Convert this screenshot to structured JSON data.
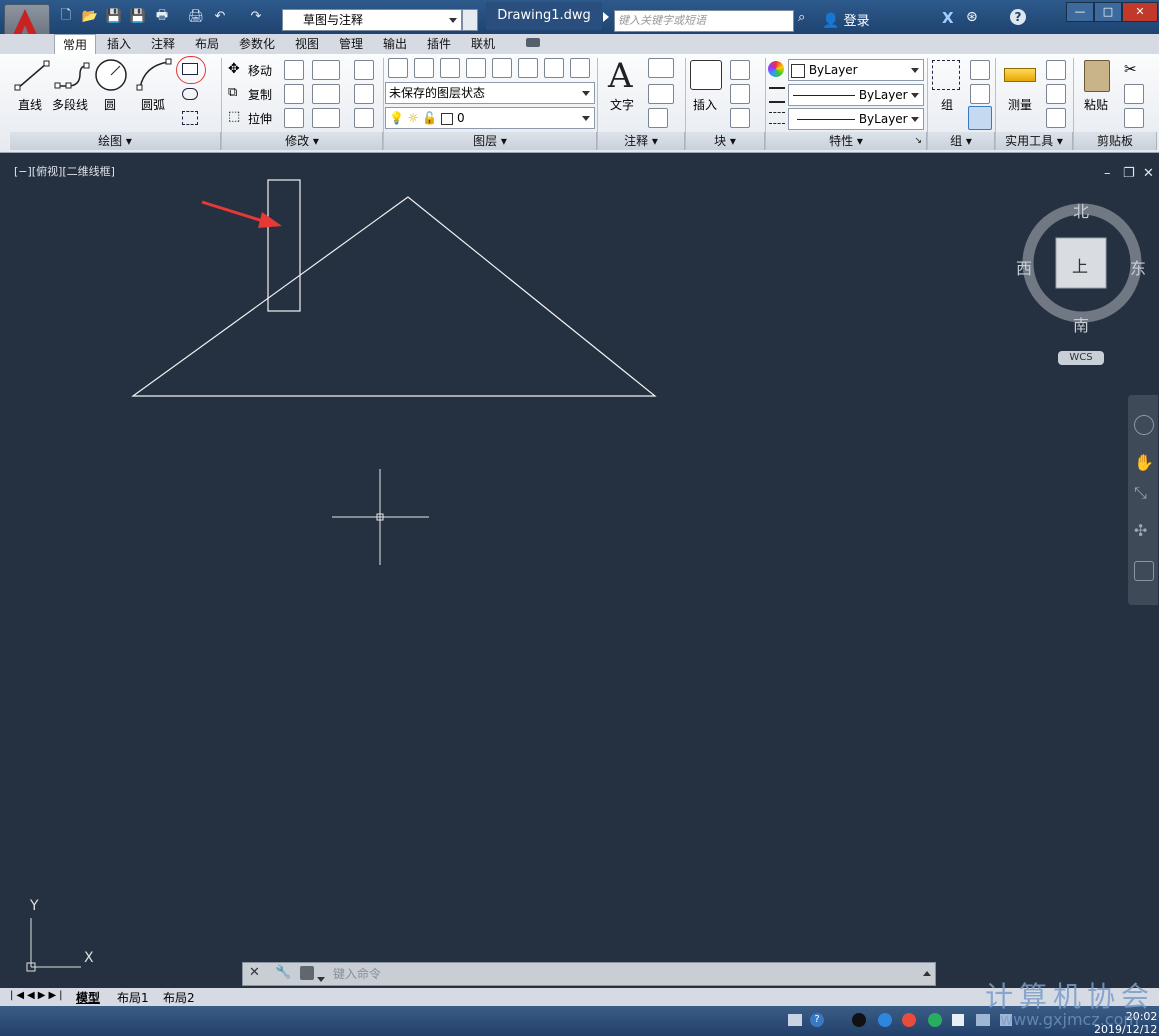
{
  "title_bar": {
    "workspace": "草图与注释",
    "document_title": "Drawing1.dwg",
    "search_placeholder": "键入关键字或短语",
    "login": "登录"
  },
  "ribbon_tabs": [
    "常用",
    "插入",
    "注释",
    "布局",
    "参数化",
    "视图",
    "管理",
    "输出",
    "插件",
    "联机"
  ],
  "draw_panel": {
    "line": "直线",
    "polyline": "多段线",
    "circle": "圆",
    "arc": "圆弧",
    "title": "绘图"
  },
  "modify_panel": {
    "move": "移动",
    "copy": "复制",
    "stretch": "拉伸",
    "title": "修改"
  },
  "layers_panel": {
    "state": "未保存的图层状态",
    "layer": "0",
    "title": "图层"
  },
  "annotation_panel": {
    "text": "文字",
    "title": "注释"
  },
  "block_panel": {
    "insert": "插入",
    "title": "块"
  },
  "properties_panel": {
    "color": "ByLayer",
    "linetype": "ByLayer",
    "lineweight": "ByLayer",
    "title": "特性"
  },
  "group_panel": {
    "group": "组",
    "title": "组"
  },
  "utilities_panel": {
    "measure": "测量",
    "title": "实用工具"
  },
  "clipboard_panel": {
    "paste": "粘贴",
    "title": "剪贴板"
  },
  "viewport_label": "[−][俯视][二维线框]",
  "viewcube": {
    "north": "北",
    "south": "南",
    "east": "东",
    "west": "西",
    "face": "上",
    "wcs": "WCS"
  },
  "ucs": {
    "x": "X",
    "y": "Y"
  },
  "command_line": {
    "placeholder": "键入命令"
  },
  "layout_tabs": [
    "模型",
    "布局1",
    "布局2"
  ],
  "taskbar": {
    "time": "20:02",
    "date": "2019/12/12"
  },
  "watermark": {
    "text": "计算机协会",
    "url": "www.gxjmcz.com"
  },
  "colors": {
    "canvas": "#253040",
    "annotation_arrow": "#e53935",
    "title_bar": "#2d5a8c"
  }
}
